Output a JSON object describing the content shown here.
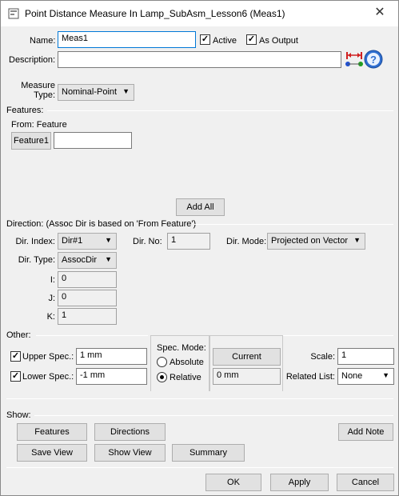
{
  "window": {
    "title": "Point Distance Measure In Lamp_SubAsm_Lesson6 (Meas1)",
    "close_glyph": "✕"
  },
  "general": {
    "name_label": "Name:",
    "name_value": "Meas1",
    "active_label": "Active",
    "active_checked": true,
    "as_output_label": "As Output",
    "as_output_checked": true,
    "description_label": "Description:",
    "description_value": "",
    "measure_type_label_1": "Measure",
    "measure_type_label_2": "Type:",
    "measure_type_value": "Nominal-Point",
    "help_glyph": "?"
  },
  "features": {
    "section_label": "Features:",
    "from_label": "From: Feature",
    "feature_button": "Feature1",
    "feature_value": "",
    "add_all_button": "Add All"
  },
  "direction": {
    "section_label": "Direction: (Assoc Dir is based on 'From Feature')",
    "dir_index_label": "Dir. Index:",
    "dir_index_value": "Dir#1",
    "dir_no_label": "Dir. No:",
    "dir_no_value": "1",
    "dir_mode_label": "Dir. Mode:",
    "dir_mode_value": "Projected on Vector",
    "dir_type_label": "Dir. Type:",
    "dir_type_value": "AssocDir",
    "i_label": "I:",
    "i_value": "0",
    "j_label": "J:",
    "j_value": "0",
    "k_label": "K:",
    "k_value": "1"
  },
  "other": {
    "section_label": "Other:",
    "upper_spec_label": "Upper Spec.:",
    "upper_spec_checked": true,
    "upper_spec_value": "1 mm",
    "lower_spec_label": "Lower Spec.:",
    "lower_spec_checked": true,
    "lower_spec_value": "-1 mm",
    "spec_mode_label": "Spec. Mode:",
    "absolute_label": "Absolute",
    "relative_label": "Relative",
    "spec_mode_selected": "Relative",
    "current_button": "Current",
    "current_value": "0 mm",
    "scale_label": "Scale:",
    "scale_value": "1",
    "related_list_label": "Related List:",
    "related_list_value": "None"
  },
  "show": {
    "section_label": "Show:",
    "features_button": "Features",
    "directions_button": "Directions",
    "add_note_button": "Add Note",
    "save_view_button": "Save View",
    "show_view_button": "Show View",
    "summary_button": "Summary"
  },
  "footer": {
    "ok_button": "OK",
    "apply_button": "Apply",
    "cancel_button": "Cancel"
  },
  "colors": {
    "accent": "#0078d7",
    "help_icon_blue": "#2f6fd0",
    "measure_icon_red": "#d02020",
    "measure_icon_blue": "#2050d0",
    "measure_icon_green": "#20a020"
  }
}
